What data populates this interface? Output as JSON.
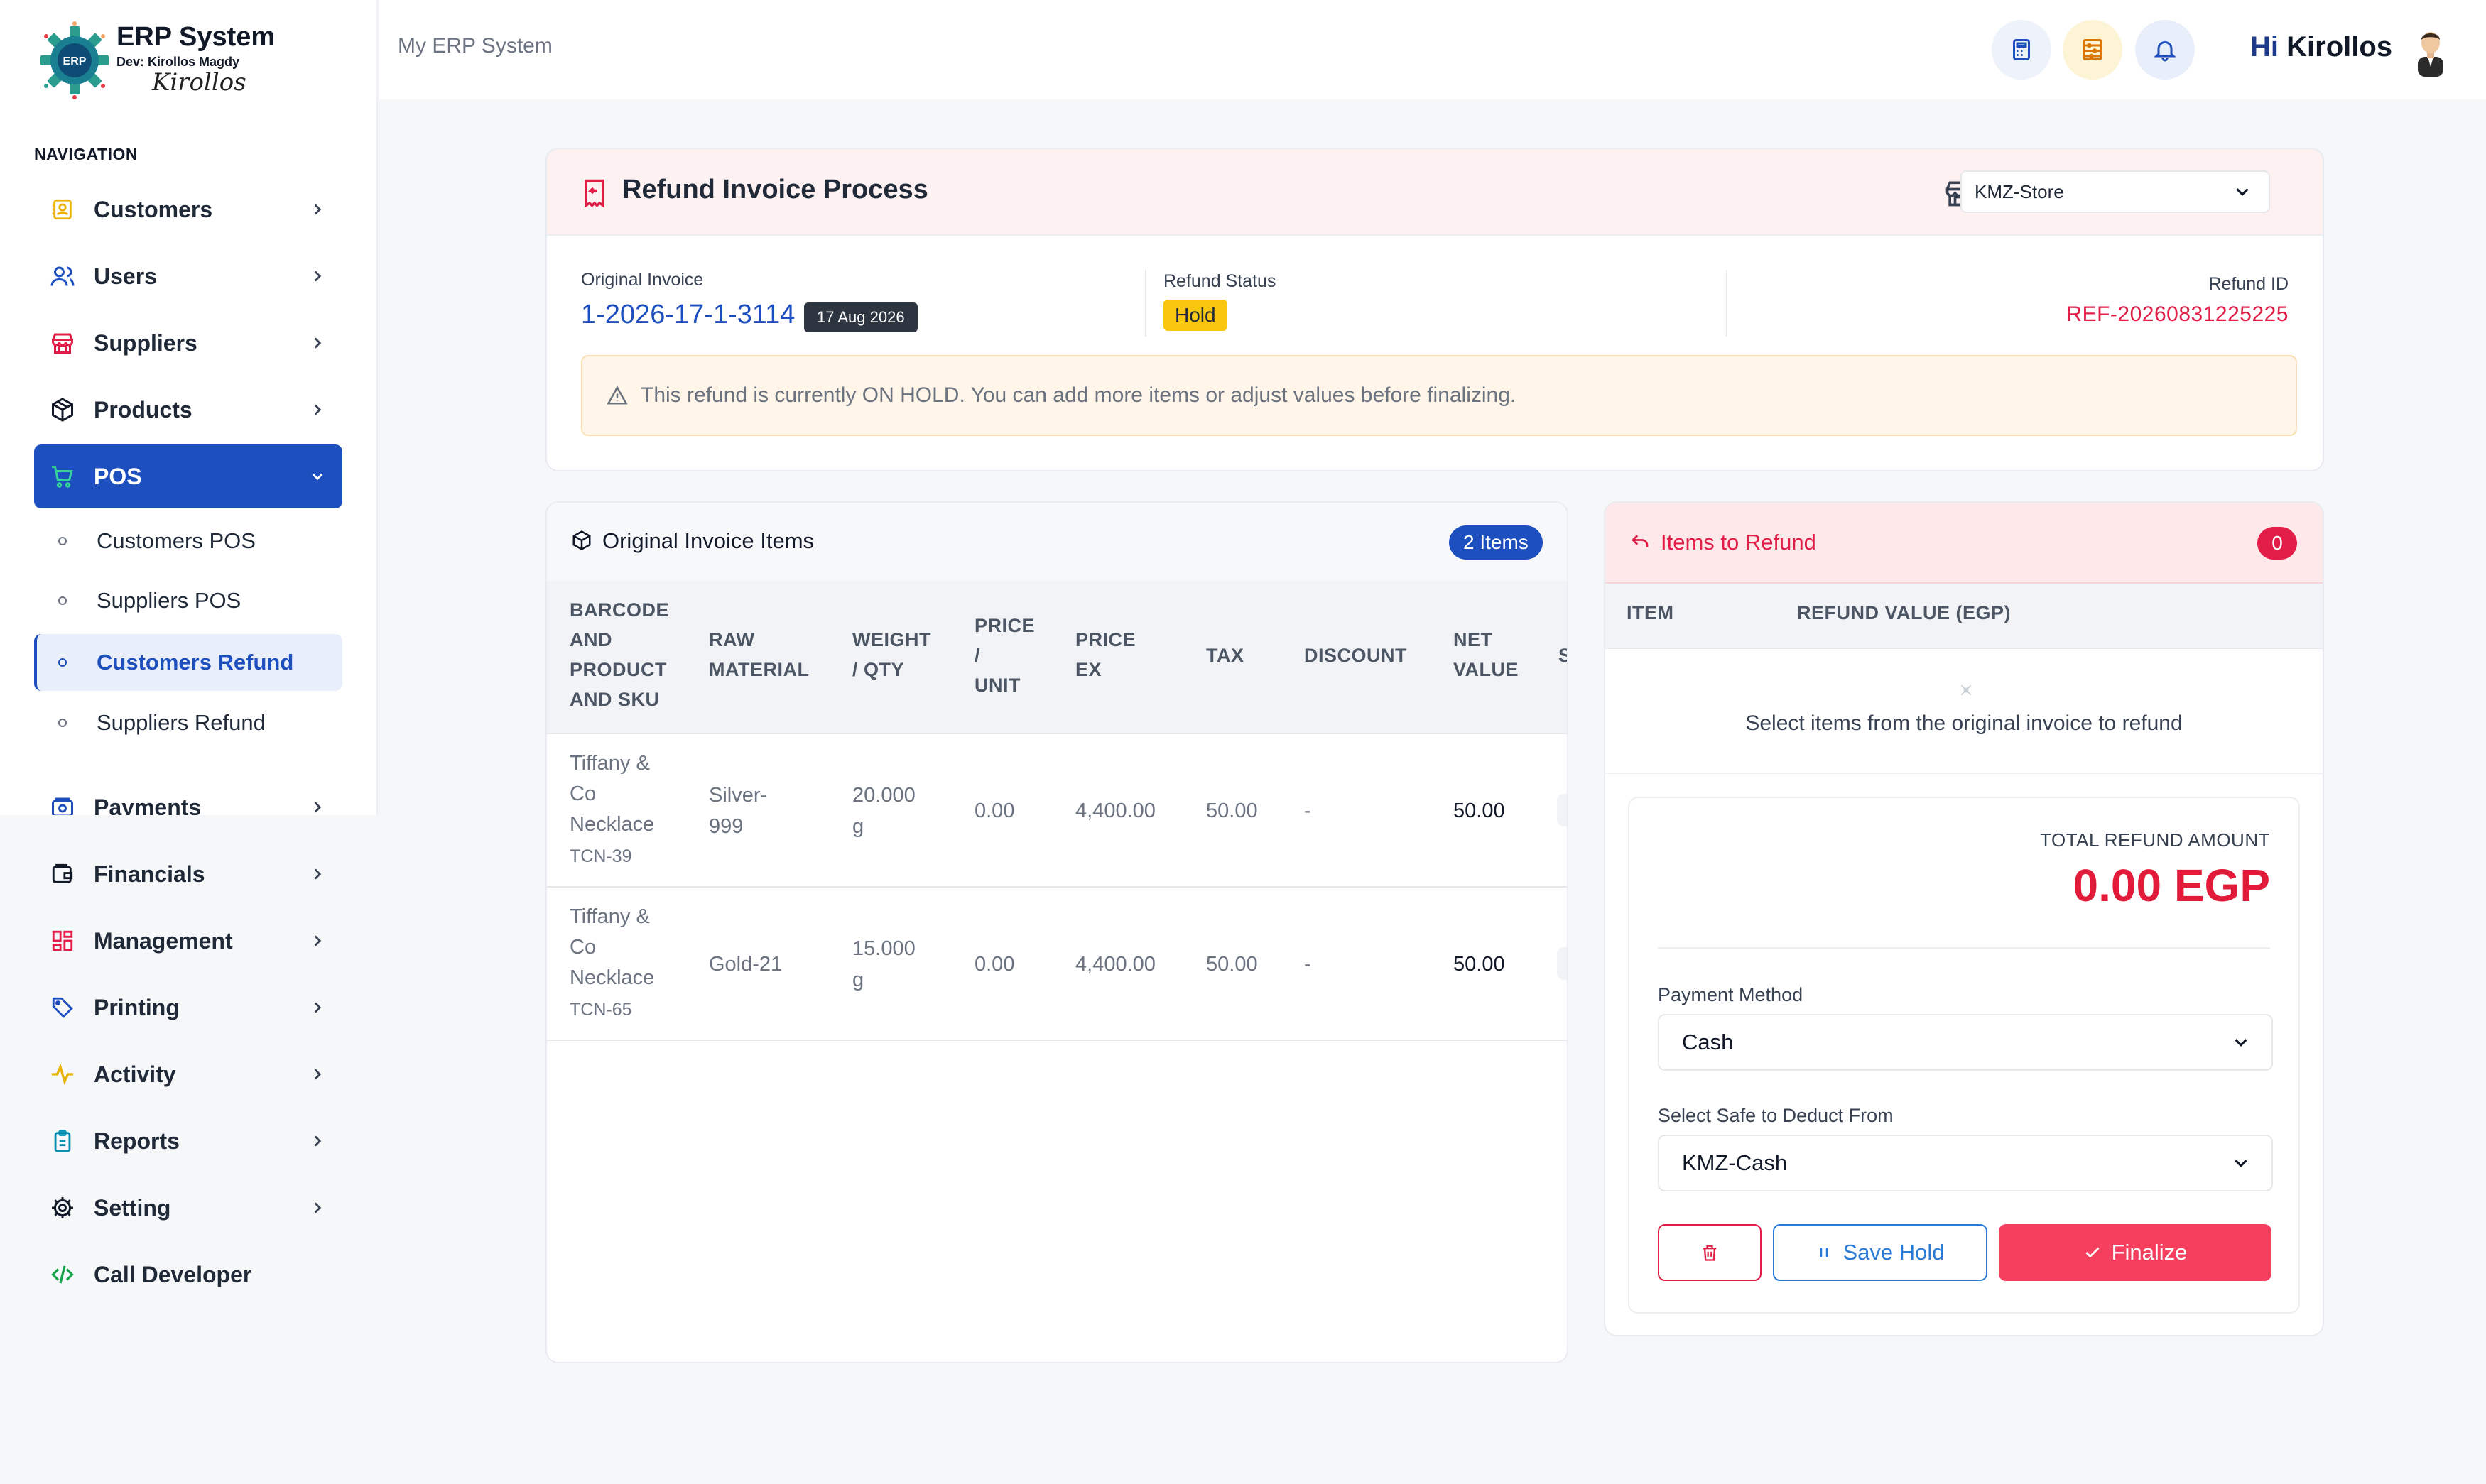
{
  "brand": {
    "title": "ERP System",
    "dev": "Dev: Kirollos Magdy",
    "signature": "Kirollos",
    "logo_text": "ERP"
  },
  "nav": {
    "heading": "NAVIGATION",
    "items_top": [
      {
        "label": "Customers",
        "icon": "contact-card-icon"
      },
      {
        "label": "Users",
        "icon": "users-icon"
      },
      {
        "label": "Suppliers",
        "icon": "store-icon"
      },
      {
        "label": "Products",
        "icon": "box-icon"
      },
      {
        "label": "POS",
        "icon": "cart-icon"
      }
    ],
    "pos_sub": [
      {
        "label": "Customers POS"
      },
      {
        "label": "Suppliers POS"
      },
      {
        "label": "Customers Refund"
      },
      {
        "label": "Suppliers Refund"
      }
    ],
    "items_bottom": [
      {
        "label": "Payments",
        "icon": "wallet-icon"
      },
      {
        "label": "Financials",
        "icon": "finance-wallet-icon"
      },
      {
        "label": "Management",
        "icon": "grid-icon"
      },
      {
        "label": "Printing",
        "icon": "tag-icon"
      },
      {
        "label": "Activity",
        "icon": "pulse-icon"
      },
      {
        "label": "Reports",
        "icon": "clipboard-icon"
      },
      {
        "label": "Setting",
        "icon": "gear-icon"
      },
      {
        "label": "Call Developer",
        "icon": "code-icon"
      }
    ]
  },
  "topbar": {
    "title": "My ERP System",
    "greeting_hi": "Hi",
    "greeting_name": "Kirollos"
  },
  "refund_header": {
    "title": "Refund Invoice Process",
    "store": "KMZ-Store",
    "original_invoice_label": "Original Invoice",
    "original_invoice_no": "1-2026-17-1-3114",
    "invoice_date": "17 Aug 2026",
    "status_label": "Refund Status",
    "status": "Hold",
    "refund_id_label": "Refund ID",
    "refund_id": "REF-20260831225225",
    "alert": "This refund is currently ON HOLD. You can add more items or adjust values before finalizing."
  },
  "items_table": {
    "title": "Original Invoice Items",
    "count_badge": "2 Items",
    "columns": {
      "barcode": [
        "BARCODE",
        "AND",
        "PRODUCT",
        "AND SKU"
      ],
      "raw": [
        "RAW",
        "MATERIAL"
      ],
      "weight": [
        "WEIGHT",
        "/ QTY"
      ],
      "price_unit": [
        "PRICE",
        "/",
        "UNIT"
      ],
      "price_ex": [
        "PRICE",
        "EX"
      ],
      "tax": "TAX",
      "discount": "DISCOUNT",
      "net": [
        "NET",
        "VALUE"
      ],
      "cut": "S"
    },
    "rows": [
      {
        "name_lines": [
          "Tiffany &",
          "Co",
          "Necklace"
        ],
        "sku": "TCN-39",
        "raw_lines": [
          "Silver-",
          "999"
        ],
        "weight_lines": [
          "20.000",
          "g"
        ],
        "price_unit": "0.00",
        "price_ex": "4,400.00",
        "tax": "50.00",
        "discount": "-",
        "net": "50.00"
      },
      {
        "name_lines": [
          "Tiffany &",
          "Co",
          "Necklace"
        ],
        "sku": "TCN-65",
        "raw_lines": [
          "Gold-21"
        ],
        "weight_lines": [
          "15.000",
          "g"
        ],
        "price_unit": "0.00",
        "price_ex": "4,400.00",
        "tax": "50.00",
        "discount": "-",
        "net": "50.00"
      }
    ]
  },
  "refund_panel": {
    "title": "Items to Refund",
    "count": "0",
    "col_item": "ITEM",
    "col_value": "REFUND VALUE (EGP)",
    "empty_text": "Select items from the original invoice to refund",
    "total_label": "TOTAL REFUND AMOUNT",
    "total_value": "0.00 EGP",
    "payment_label": "Payment Method",
    "payment_value": "Cash",
    "safe_label": "Select Safe to Deduct From",
    "safe_value": "KMZ-Cash",
    "save_hold": "Save Hold",
    "finalize": "Finalize"
  },
  "colors": {
    "primary": "#1e4fbf",
    "danger": "#e11d48",
    "hold": "#f9c80e"
  }
}
